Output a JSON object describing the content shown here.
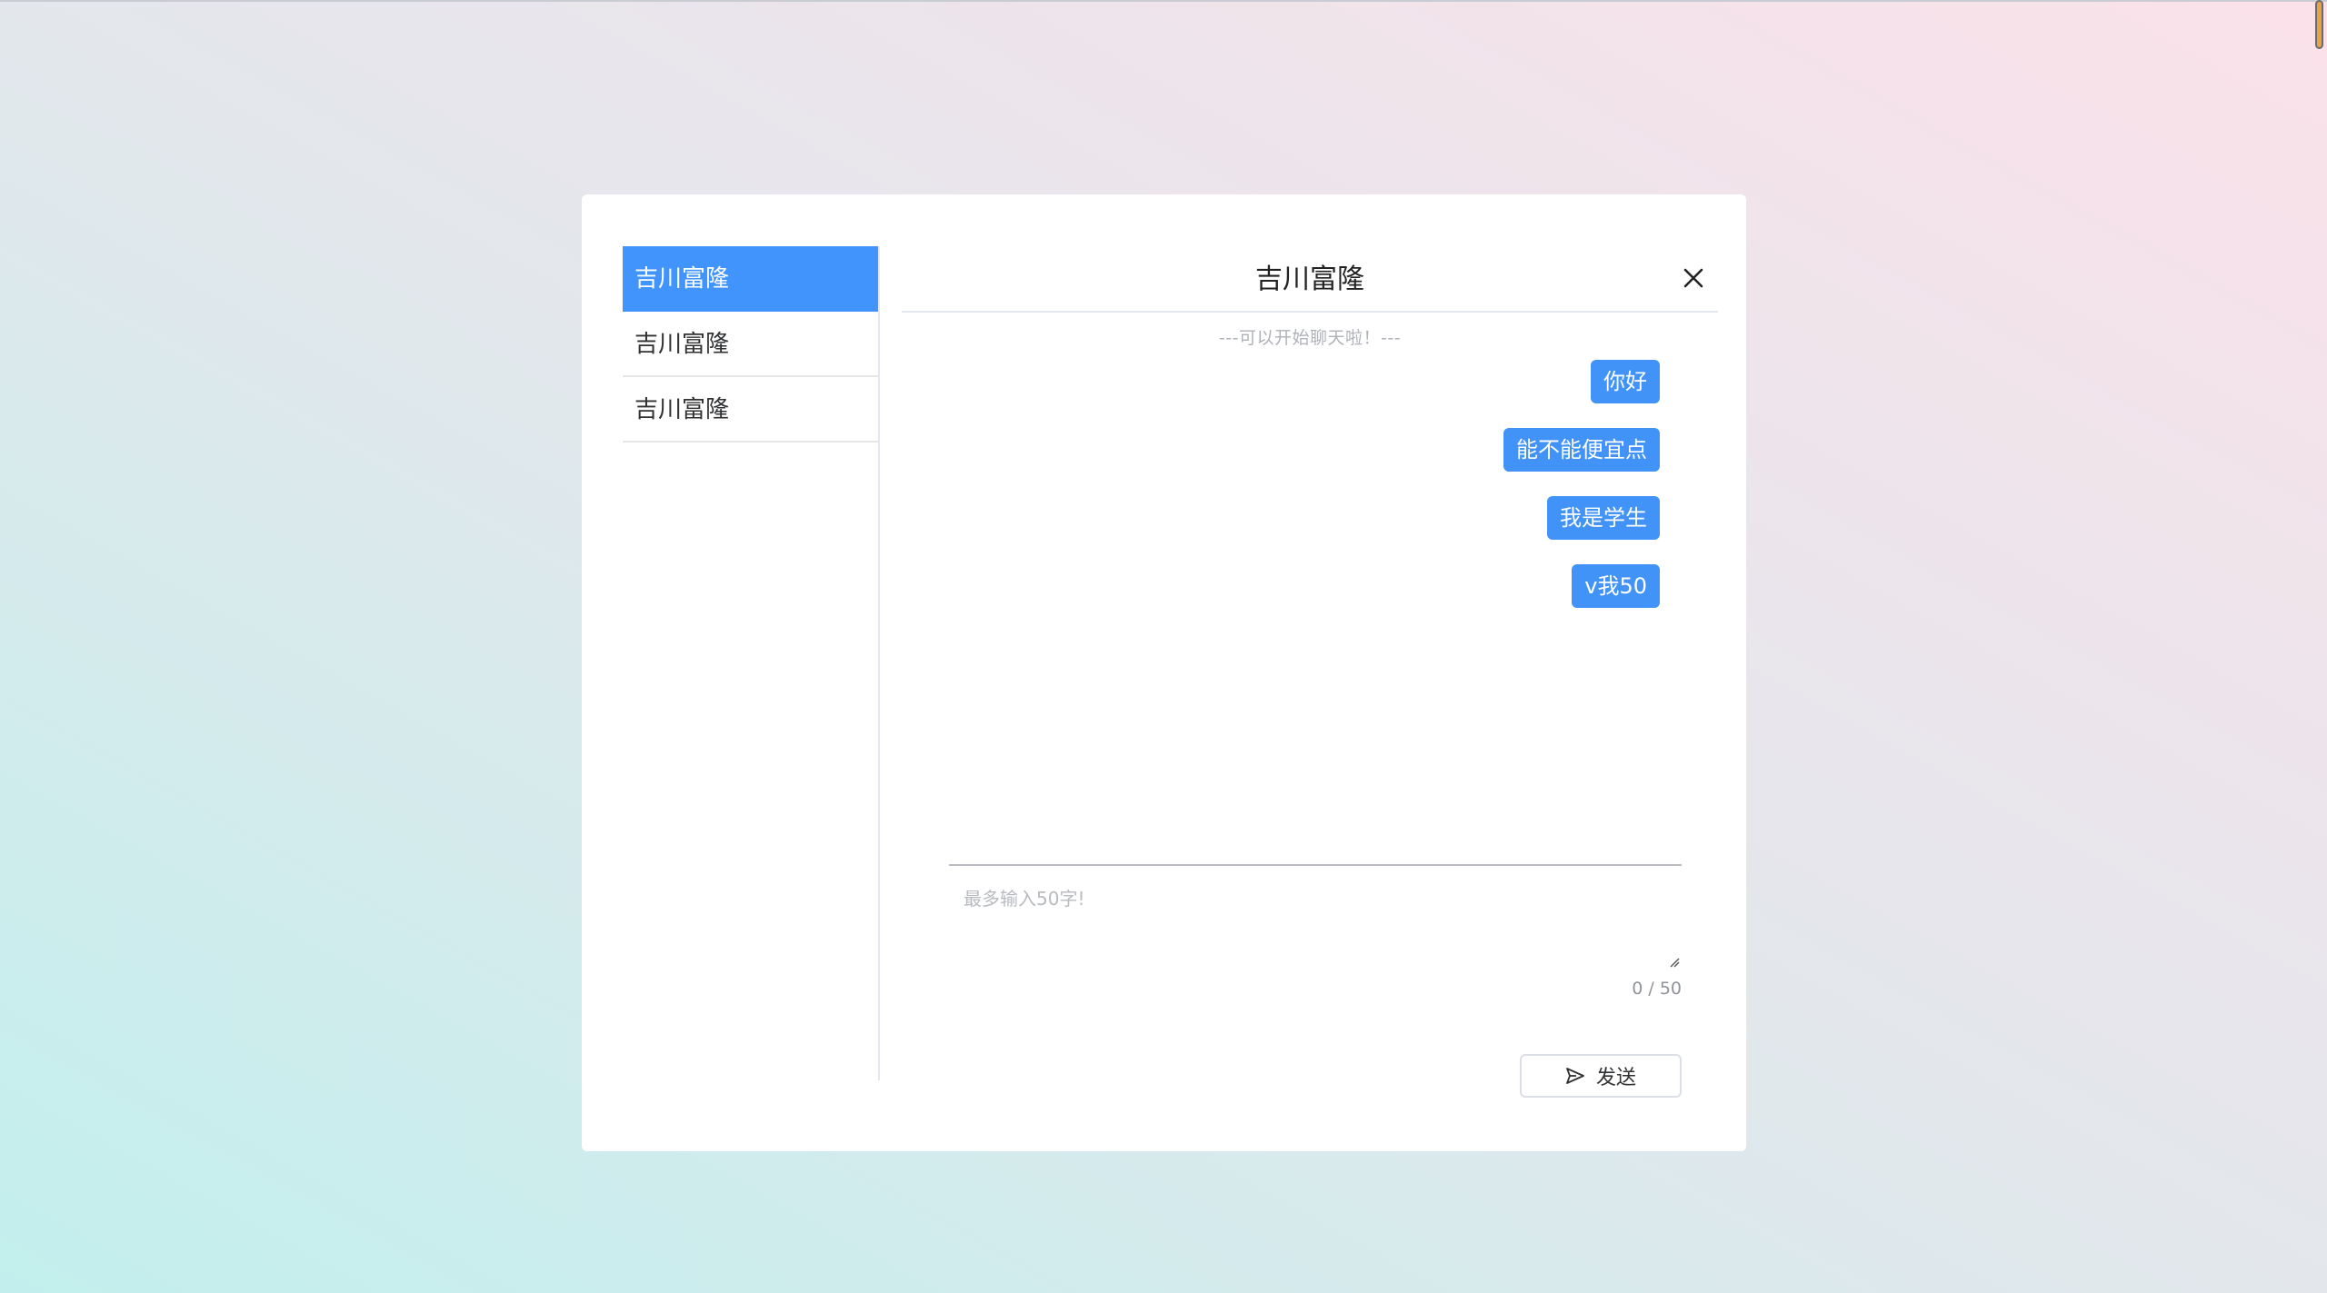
{
  "contacts": [
    {
      "name": "吉川富隆",
      "active": true
    },
    {
      "name": "吉川富隆",
      "active": false
    },
    {
      "name": "吉川富隆",
      "active": false
    }
  ],
  "chat": {
    "title": "吉川富隆",
    "notice": "---可以开始聊天啦！---",
    "messages": [
      "你好",
      "能不能便宜点",
      "我是学生",
      "v我50"
    ],
    "input": {
      "placeholder": "最多输入50字!",
      "value": "",
      "counter": "0 / 50"
    },
    "send_label": "发送",
    "icons": {
      "close": "close-icon",
      "send": "send-icon",
      "resize": "resize-grip-icon"
    }
  },
  "colors": {
    "accent": "#4194fb",
    "bubble": "#4193f8"
  }
}
